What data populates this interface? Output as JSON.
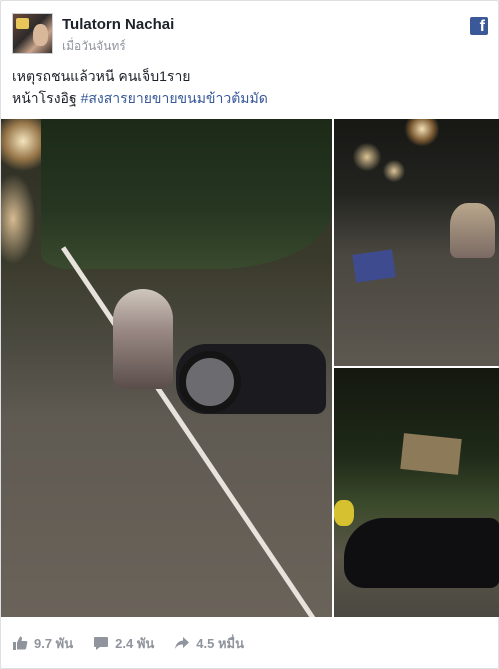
{
  "post": {
    "author": "Tulatorn Nachai",
    "timestamp": "เมื่อวันจันทร์",
    "text_line1": "เหตุรถชนแล้วหนี คนเจ็บ1ราย",
    "text_line2_prefix": "หน้าโรงอิฐ ",
    "hashtag": "#สงสารยายขายขนมข้าวต้มมัด"
  },
  "icons": {
    "avatar": "profile-avatar",
    "brand": "facebook-logo-icon",
    "like": "thumbs-up-icon",
    "comment": "comment-bubble-icon",
    "share": "share-arrow-icon"
  },
  "actions": {
    "likes": "9.7 พัน",
    "comments": "2.4 พัน",
    "shares": "4.5 หมื่น"
  },
  "colors": {
    "link": "#365899",
    "brand": "#3b5998",
    "meta": "#90949c"
  }
}
